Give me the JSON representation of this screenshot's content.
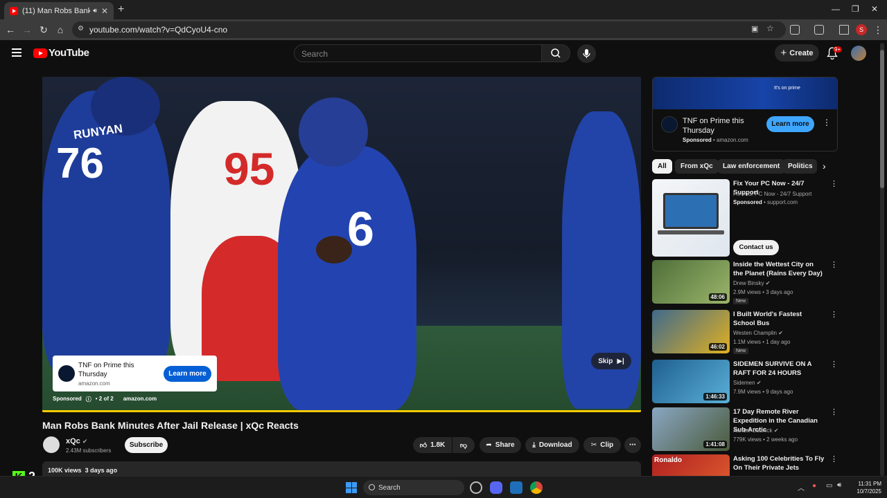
{
  "browser": {
    "tab_title": "(11) Man Robs Bank Minute",
    "url": "youtube.com/watch?v=QdCyoU4-cno",
    "profile_initial": "S"
  },
  "youtube": {
    "logo_text": "YouTube",
    "search_placeholder": "Search",
    "create_label": "Create",
    "notification_badge": "9+"
  },
  "player": {
    "ad_card_title": "TNF on Prime this Thursday",
    "ad_card_domain": "amazon.com",
    "ad_card_button": "Learn more",
    "ad_sponsored": "Sponsored",
    "ad_count": "• 2 of 2",
    "ad_domain": "amazon.com",
    "skip_label": "Skip",
    "progress": 1.0,
    "jersey_1": "76",
    "jersey_2": "95",
    "jersey_3": "6",
    "name_on_jersey": "RUNYAN"
  },
  "video": {
    "title": "Man Robs Bank Minutes After Jail Release | xQc Reacts",
    "channel": "xQc",
    "subscribers": "2.43M subscribers",
    "subscribe_label": "Subscribe",
    "likes": "1.8K",
    "share_label": "Share",
    "download_label": "Download",
    "clip_label": "Clip",
    "views": "100K views",
    "age": "3 days ago"
  },
  "sidebar_ad": {
    "banner_text": "It's on prime",
    "title": "TNF on Prime this Thursday",
    "sponsored": "Sponsored",
    "domain": "amazon.com",
    "button": "Learn more"
  },
  "chips": [
    "All",
    "From xQc",
    "Law enforcement",
    "Politics"
  ],
  "promo": {
    "title": "Fix Your PC Now - 24/7 Support",
    "subtitle": "Fix Your PC Now - 24/7 Support",
    "sponsored": "Sponsored",
    "domain": "support.com",
    "button": "Contact us"
  },
  "recommendations": [
    {
      "title": "Inside the Wettest City on the Planet (Rains Every Day)",
      "channel": "Drew Binsky",
      "meta": "2.9M views • 3 days ago",
      "duration": "48:06",
      "badge": "New",
      "color_a": "#4f6f3a",
      "color_b": "#9ab56a"
    },
    {
      "title": "I Built World's Fastest School Bus",
      "channel": "Westen Champlin",
      "meta": "1.1M views • 1 day ago",
      "duration": "46:02",
      "badge": "New",
      "color_a": "#3f6a8c",
      "color_b": "#e0b020"
    },
    {
      "title": "SIDEMEN SURVIVE ON A RAFT FOR 24 HOURS",
      "channel": "Sidemen",
      "meta": "7.9M views • 9 days ago",
      "duration": "1:46:33",
      "badge": "",
      "color_a": "#1f5f8f",
      "color_b": "#5ab0d8"
    },
    {
      "title": "17 Day Remote River Expedition in the Canadian Sub-Arctic",
      "channel": "Xander Budnick",
      "meta": "779K views • 2 weeks ago",
      "duration": "1:41:08",
      "badge": "",
      "color_a": "#8aa7c4",
      "color_b": "#4a5a3a"
    },
    {
      "title": "Asking 100 Celebrities To Fly On Their Private Jets",
      "channel": "",
      "meta": "",
      "duration": "",
      "badge": "",
      "thumb_text": "Ronaldo",
      "color_a": "#b02020",
      "color_b": "#e06030"
    }
  ],
  "overlay": {
    "kick_letter": "K",
    "count": "2"
  },
  "taskbar": {
    "search": "Search",
    "time": "11:31 PM",
    "date": "10/7/2025"
  },
  "colors": {
    "bg": "#0f0f0f",
    "accent_red": "#ff0000",
    "learn_more_blue": "#065fd4",
    "progress_yellow": "#ffcc00",
    "kick_green": "#53fc18"
  }
}
